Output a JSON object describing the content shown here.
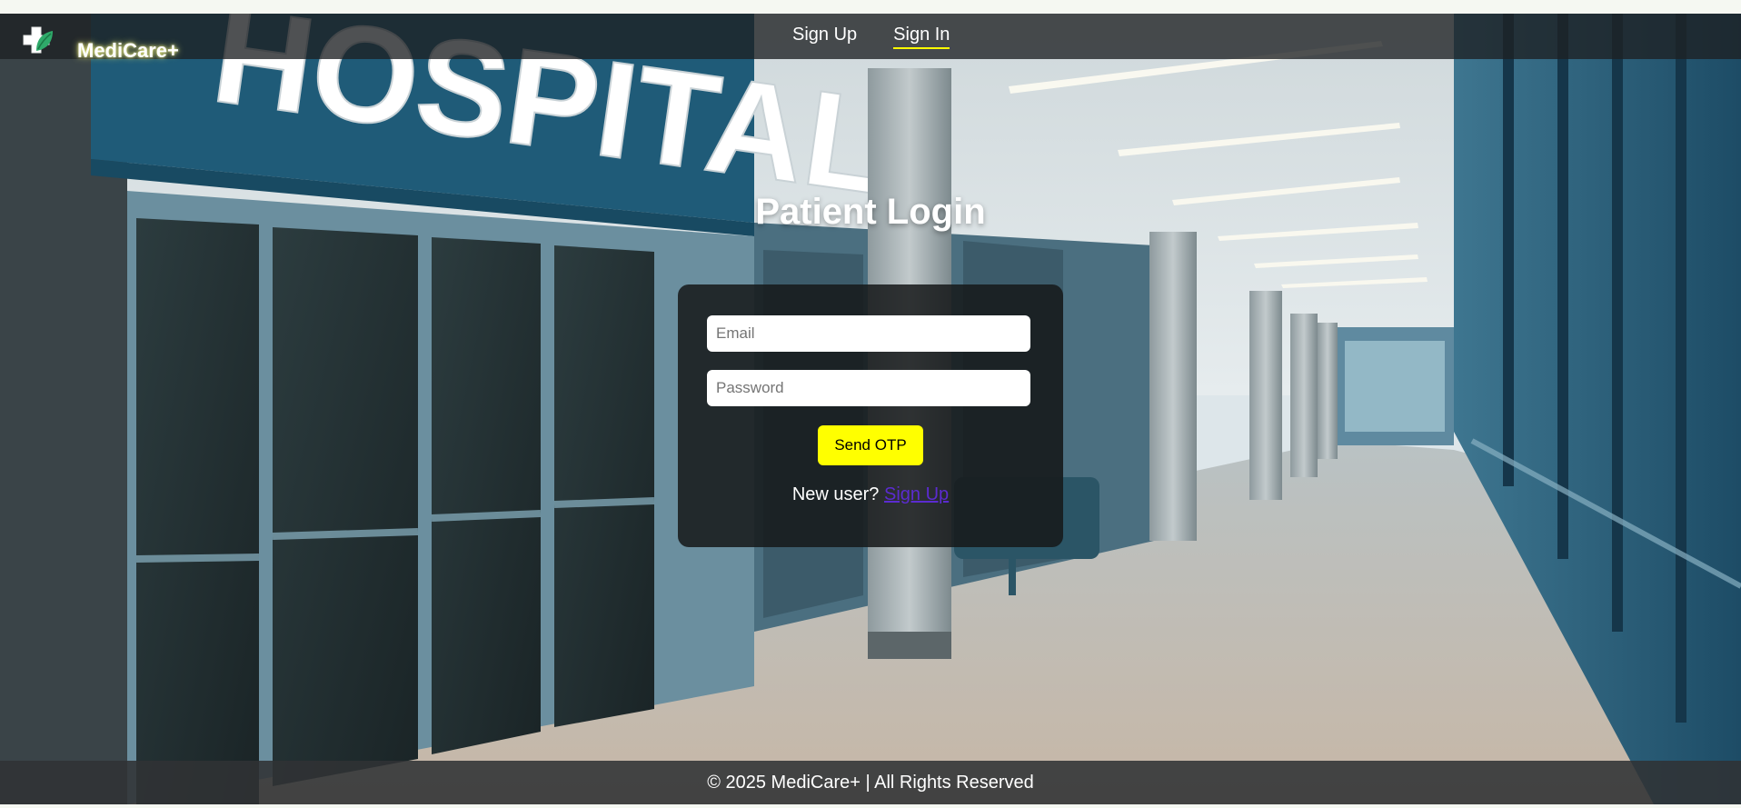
{
  "brand": {
    "name": "MediCare+",
    "logo_icon": "medical-cross-leaf-icon"
  },
  "nav": {
    "sign_up": "Sign Up",
    "sign_in": "Sign In",
    "active": "sign_in"
  },
  "login": {
    "title": "Patient Login",
    "email_placeholder": "Email",
    "password_placeholder": "Password",
    "submit_label": "Send OTP",
    "new_user_text": "New user?",
    "signup_link": "Sign Up"
  },
  "background": {
    "sign_text": "HOSPITAL"
  },
  "footer": {
    "text": "© 2025 MediCare+ | All Rights Reserved"
  },
  "colors": {
    "accent": "#ffff00",
    "link": "#5b2bd0",
    "overlay": "#1e2022"
  }
}
